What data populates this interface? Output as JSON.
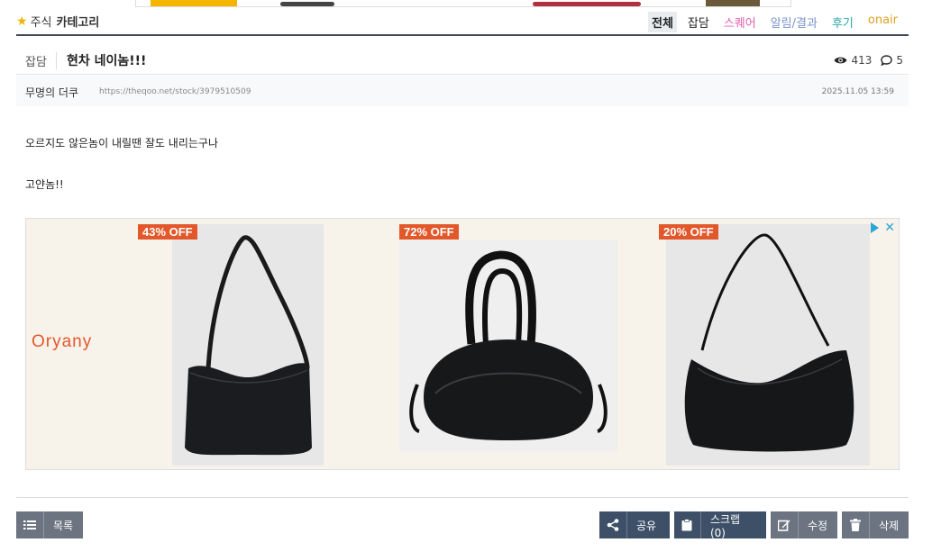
{
  "category_bar": {
    "board": "주식",
    "label": "카테고리",
    "tabs": [
      "전체",
      "잡담",
      "스퀘어",
      "알림/결과",
      "후기",
      "onair"
    ]
  },
  "post": {
    "category": "잡담",
    "title": "현차 네이놈!!!",
    "views": "413",
    "comments": "5",
    "author": "무명의 더쿠",
    "url": "https://theqoo.net/stock/3979510509",
    "date": "2025.11.05 13:59",
    "body": [
      "오르지도 않은놈이 내릴땐 잘도 내리는구나",
      "고얀놈!!"
    ]
  },
  "ad": {
    "brand": "Oryany",
    "offers": [
      "43% OFF",
      "72% OFF",
      "20% OFF"
    ]
  },
  "buttons": {
    "list": "목록",
    "share": "공유",
    "scrap": "스크랩 (0)",
    "edit": "수정",
    "delete": "삭제"
  },
  "colors": {
    "nav_line": "#3d4a5a",
    "button_dark": "#3d5068",
    "button_gray": "#6b7480",
    "ad_accent": "#e2582b"
  }
}
